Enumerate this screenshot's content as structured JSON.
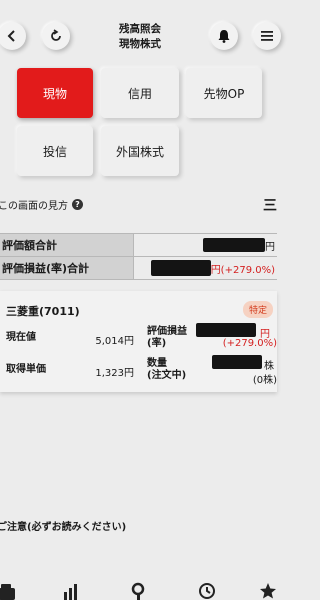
{
  "header": {
    "title_line1": "残高照会",
    "title_line2": "現物株式"
  },
  "tabs": [
    {
      "label": "現物",
      "active": true
    },
    {
      "label": "信用",
      "active": false
    },
    {
      "label": "先物OP",
      "active": false
    },
    {
      "label": "投信",
      "active": false
    },
    {
      "label": "外国株式",
      "active": false
    }
  ],
  "howto": {
    "label": "この画面の見方",
    "right_glyph": "三"
  },
  "summary": {
    "valuation_label": "評価額合計",
    "valuation_suffix": "円",
    "pl_label": "評価損益(率)合計",
    "pl_suffix": "円(+279.0%)"
  },
  "holding": {
    "name": "三菱重(7011)",
    "badge": "特定",
    "current_price_label": "現在値",
    "current_price": "5,014円",
    "unit_cost_label": "取得単価",
    "unit_cost": "1,323円",
    "pl_label_line1": "評価損益",
    "pl_label_line2": "(率)",
    "pl_rate": "(+279.0%)",
    "pl_suffix": "円",
    "qty_label_line1": "数量",
    "qty_label_line2": "(注文中)",
    "qty_suffix": "株",
    "qty_pending": "(0株)"
  },
  "notice": "ご注意(必ずお読みください)",
  "colors": {
    "accent": "#e21b1b",
    "gain": "#d42020",
    "badge_bg": "#f6d2c2"
  }
}
